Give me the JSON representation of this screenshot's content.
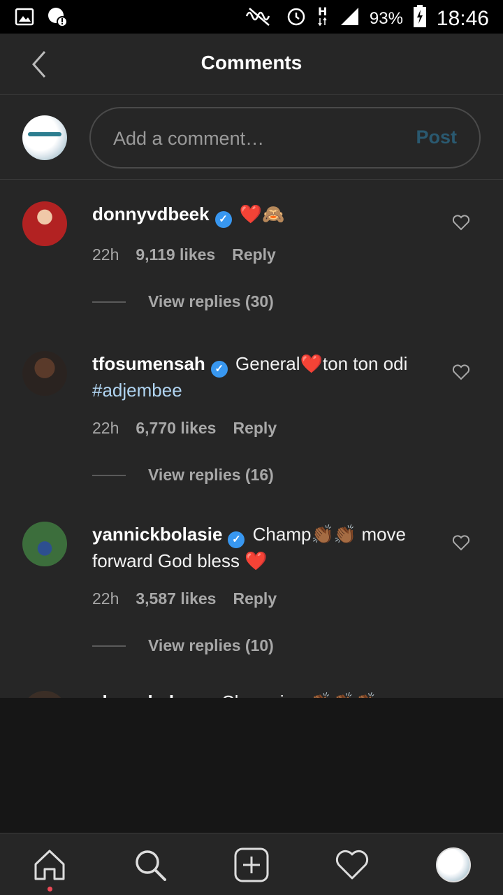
{
  "status_bar": {
    "battery_percent": "93%",
    "time": "18:46",
    "icons": [
      "gallery-icon",
      "notification-icon",
      "mute-icon",
      "alarm-icon",
      "network-h-icon",
      "signal-icon",
      "battery-icon"
    ]
  },
  "header": {
    "title": "Comments"
  },
  "composer": {
    "placeholder": "Add a comment…",
    "post_label": "Post"
  },
  "comments": [
    {
      "username": "donnyvdbeek",
      "text": "❤️🙈",
      "hashtag": "",
      "time": "22h",
      "likes": "9,119 likes",
      "reply_label": "Reply",
      "view_replies": "View replies (30)"
    },
    {
      "username": "tfosumensah",
      "text": "General❤️ton ton odi",
      "hashtag": "#adjembee",
      "time": "22h",
      "likes": "6,770 likes",
      "reply_label": "Reply",
      "view_replies": "View replies (16)"
    },
    {
      "username": "yannickbolasie",
      "text": "Champ👏🏾👏🏾 move forward God bless ❤️",
      "hashtag": "",
      "time": "22h",
      "likes": "3,587 likes",
      "reply_label": "Reply",
      "view_replies": "View replies (10)"
    },
    {
      "username": "alexxakubo",
      "text": "Champion 👏🏾👏🏾👏🏾"
    }
  ],
  "bottom_nav": [
    "home-icon",
    "search-icon",
    "add-post-icon",
    "activity-heart-icon",
    "profile-avatar"
  ]
}
